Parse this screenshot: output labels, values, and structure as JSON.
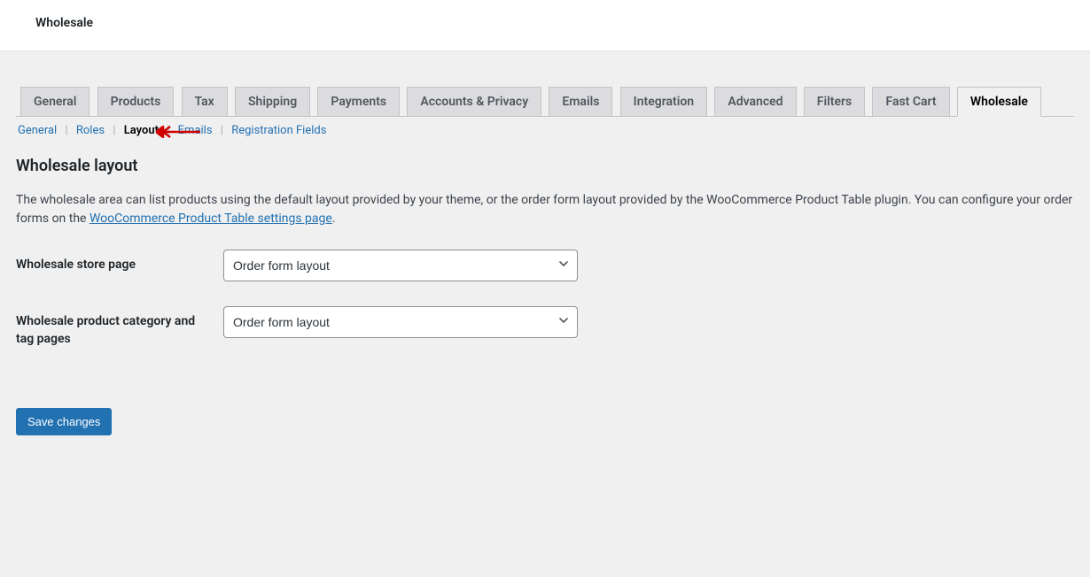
{
  "header": {
    "title": "Wholesale"
  },
  "tabs": [
    {
      "label": "General"
    },
    {
      "label": "Products"
    },
    {
      "label": "Tax"
    },
    {
      "label": "Shipping"
    },
    {
      "label": "Payments"
    },
    {
      "label": "Accounts & Privacy"
    },
    {
      "label": "Emails"
    },
    {
      "label": "Integration"
    },
    {
      "label": "Advanced"
    },
    {
      "label": "Filters"
    },
    {
      "label": "Fast Cart"
    },
    {
      "label": "Wholesale"
    }
  ],
  "subtabs": [
    {
      "label": "General"
    },
    {
      "label": "Roles"
    },
    {
      "label": "Layout"
    },
    {
      "label": "Emails"
    },
    {
      "label": "Registration Fields"
    }
  ],
  "section": {
    "title": "Wholesale layout",
    "description_part1": "The wholesale area can list products using the default layout provided by your theme, or the order form layout provided by the WooCommerce Product Table plugin. You can configure your order forms on the ",
    "description_link": "WooCommerce Product Table settings page",
    "description_part2": "."
  },
  "fields": {
    "store_page": {
      "label": "Wholesale store page",
      "value": "Order form layout"
    },
    "category_tag": {
      "label": "Wholesale product category and tag pages",
      "value": "Order form layout"
    }
  },
  "button": {
    "save": "Save changes"
  }
}
